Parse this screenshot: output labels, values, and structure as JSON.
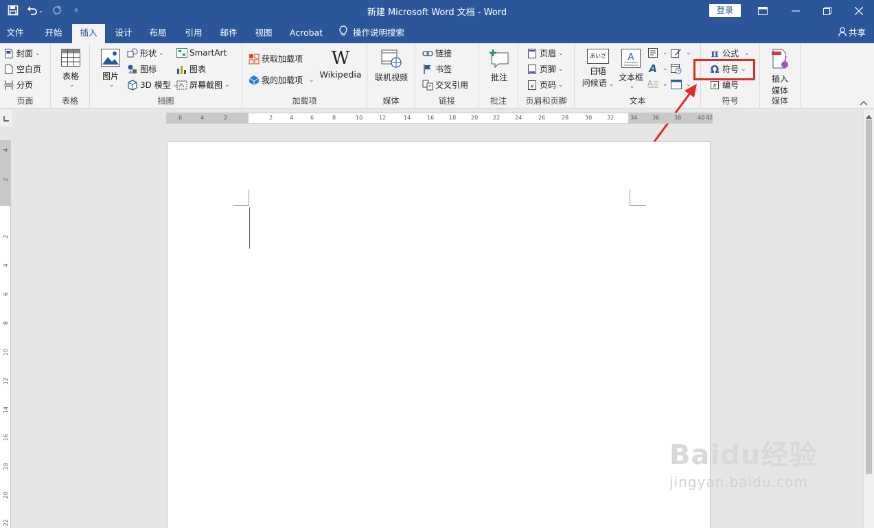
{
  "title": "新建 Microsoft Word 文档  -  Word",
  "login_label": "登录",
  "qat": {
    "save_icon": "save-icon",
    "undo_icon": "undo-icon",
    "redo_icon": "redo-icon",
    "customize_icon": "customize-qat-icon"
  },
  "tabs": [
    "文件",
    "开始",
    "插入",
    "设计",
    "布局",
    "引用",
    "邮件",
    "视图",
    "Acrobat",
    "操作说明搜索"
  ],
  "share_label": "共享",
  "ribbon": {
    "pages": {
      "cover": "封面",
      "blank": "空白页",
      "break": "分页",
      "label": "页面"
    },
    "table": {
      "table": "表格",
      "label": "表格"
    },
    "illustrations": {
      "picture": "图片",
      "shapes": "形状",
      "icons": "图标",
      "model3d": "3D 模型",
      "smartart": "SmartArt",
      "chart": "图表",
      "screenshot": "屏幕截图",
      "label": "插图"
    },
    "addins": {
      "get": "获取加载项",
      "my": "我的加载项",
      "wikipedia": "Wikipedia",
      "label": "加载项"
    },
    "media": {
      "video": "联机视频",
      "label": "媒体"
    },
    "links": {
      "link": "链接",
      "bookmark": "书签",
      "crossref": "交叉引用",
      "label": "链接"
    },
    "comments": {
      "comment": "批注",
      "label": "批注"
    },
    "headerfooter": {
      "header": "页眉",
      "footer": "页脚",
      "pagenum": "页码",
      "label": "页眉和页脚"
    },
    "text": {
      "ime_line1": "日语",
      "ime_line2": "问候语",
      "textbox": "文本框",
      "ime_icon_text": "あいさつ",
      "label": "文本"
    },
    "symbols": {
      "equation": "公式",
      "symbol": "符号",
      "number": "编号",
      "label": "符号"
    },
    "media2": {
      "insert_line1": "插入",
      "insert_line2": "媒体",
      "label": "媒体"
    }
  },
  "hruler_ticks": [
    "6",
    "4",
    "2",
    "2",
    "4",
    "6",
    "8",
    "10",
    "12",
    "14",
    "16",
    "18",
    "20",
    "22",
    "24",
    "26",
    "28",
    "30",
    "32",
    "34",
    "36",
    "38",
    "40",
    "42"
  ],
  "vruler_ticks": [
    "4",
    "2",
    "2",
    "4",
    "6",
    "8",
    "10",
    "12",
    "14",
    "16",
    "18",
    "20",
    "22"
  ],
  "watermark": {
    "brand": "Baidu经验",
    "url": "jingyan.baidu.com"
  },
  "colors": {
    "brand": "#2b579a",
    "highlight": "#e02b2b"
  }
}
